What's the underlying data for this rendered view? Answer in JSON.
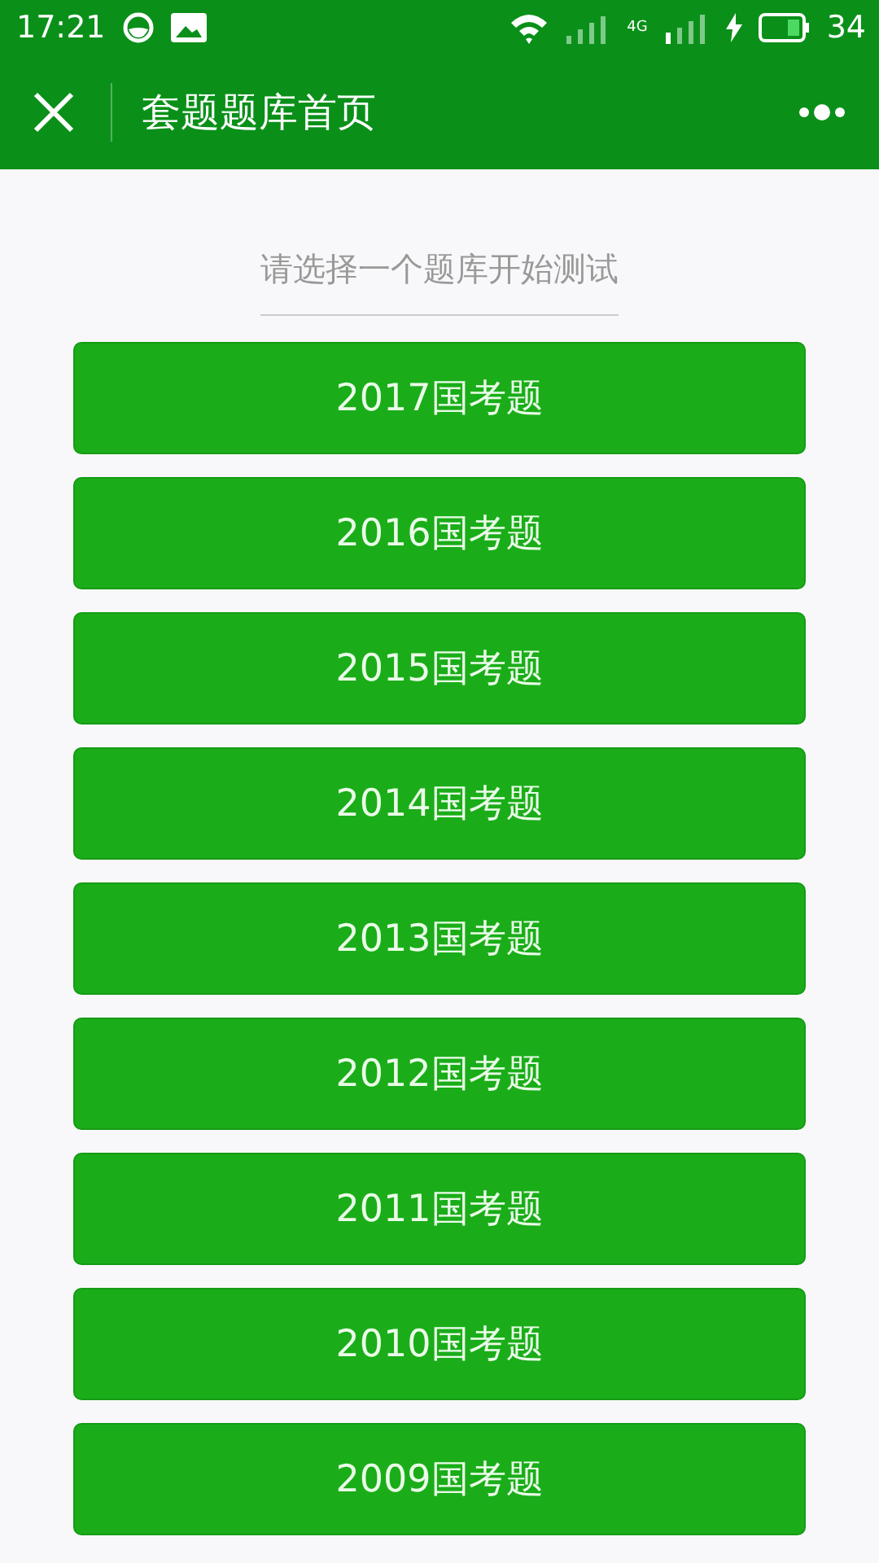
{
  "status_bar": {
    "time": "17:21",
    "network": "4G",
    "battery": "34"
  },
  "nav_bar": {
    "title": "套题题库首页"
  },
  "prompt": "请选择一个题库开始测试",
  "banks": [
    {
      "label": "2017国考题"
    },
    {
      "label": "2016国考题"
    },
    {
      "label": "2015国考题"
    },
    {
      "label": "2014国考题"
    },
    {
      "label": "2013国考题"
    },
    {
      "label": "2012国考题"
    },
    {
      "label": "2011国考题"
    },
    {
      "label": "2010国考题"
    },
    {
      "label": "2009国考题"
    }
  ]
}
